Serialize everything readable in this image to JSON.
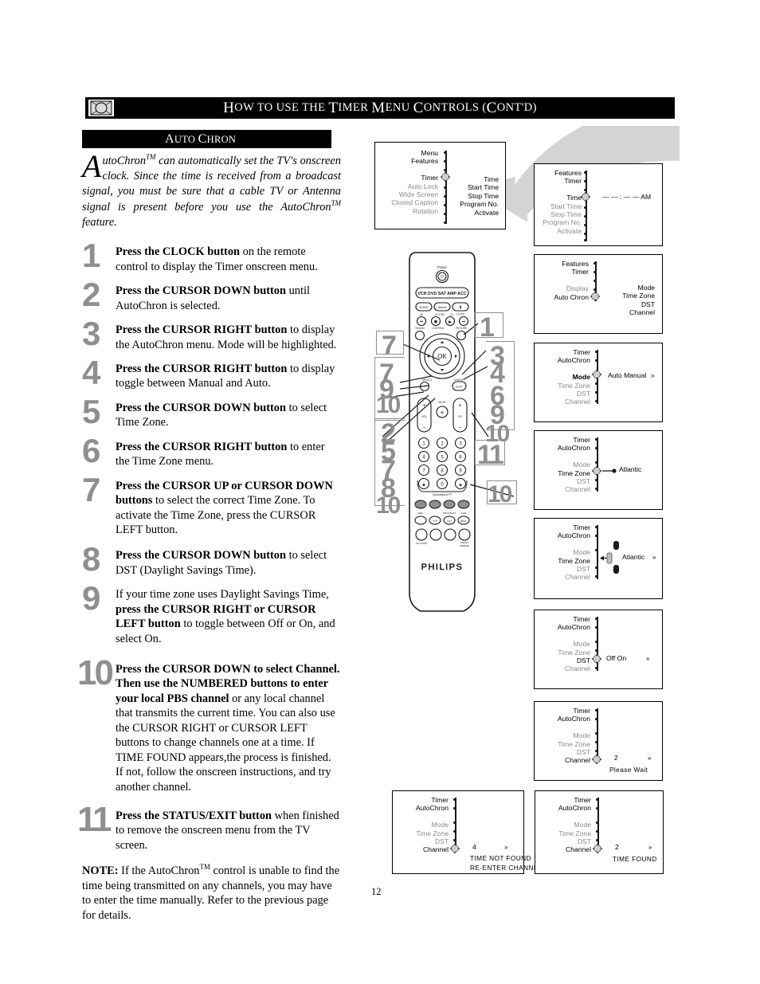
{
  "header": {
    "icon": "tv-remote-icon",
    "title_parts": [
      "H",
      "OW TO USE THE ",
      "T",
      "IMER ",
      "M",
      "ENU ",
      "C",
      "ONTROLS (",
      "C",
      "ONT",
      "'",
      "D)"
    ],
    "title": "How to use the Timer Menu Controls (Cont'd)"
  },
  "section": {
    "title_first": "A",
    "title_rest1": "UTO ",
    "title_second": "C",
    "title_rest2": "HRON",
    "title": "Auto Chron"
  },
  "intro": {
    "dropcap": "A",
    "text_1": "utoChron",
    "tm": "TM",
    "text_2": " can automatically set the TV's onscreen clock. Since the time is received from a broadcast signal, you must be sure that a cable TV or Antenna signal is present before you use the AutoChron",
    "tm2": "TM",
    "text_3": " feature."
  },
  "steps": [
    {
      "num": "1",
      "bold": "Press the CLOCK button",
      "rest": " on the remote control to display the Timer onscreen menu."
    },
    {
      "num": "2",
      "bold": "Press the CURSOR DOWN button",
      "rest": " until AutoChron is selected."
    },
    {
      "num": "3",
      "bold": "Press the CURSOR RIGHT button",
      "rest": " to display the AutoChron menu. Mode will be highlighted."
    },
    {
      "num": "4",
      "bold": "Press the CURSOR RIGHT button",
      "rest": " to display toggle between Manual and Auto."
    },
    {
      "num": "5",
      "bold": "Press the CURSOR DOWN button",
      "rest": " to select Time Zone."
    },
    {
      "num": "6",
      "bold": "Press the CURSOR RIGHT button",
      "rest": " to enter the Time Zone menu."
    },
    {
      "num": "7",
      "bold": "Press the CURSOR UP or CURSOR DOWN buttons",
      "rest": " to select the correct Time Zone. To activate the Time Zone, press the CURSOR LEFT button."
    },
    {
      "num": "8",
      "bold": "Press the CURSOR DOWN button",
      "rest": " to select DST (Daylight Savings Time)."
    },
    {
      "num": "9",
      "pre": "If your time zone uses Daylight Savings Time, ",
      "bold": "press the CURSOR RIGHT or CURSOR LEFT button",
      "rest": " to toggle between Off or On, and select On."
    },
    {
      "num": "10",
      "bold": "Press the CURSOR DOWN to select Channel. Then use the NUMBERED buttons to enter your local PBS channel",
      "rest": " or any local channel that transmits the current time.  You can also use the CURSOR RIGHT or CURSOR LEFT buttons to change channels one at a time. If TIME FOUND appears,the process is finished. If not, follow the onscreen instructions, and try another channel."
    },
    {
      "num": "11",
      "bold": "Press the STATUS/EXIT button",
      "rest": " when finished to remove the onscreen menu from the TV screen."
    }
  ],
  "note": {
    "label": "NOTE:",
    "text_1": " If the AutoChron",
    "tm": "TM",
    "text_2": " control is unable to find the time being transmitted on any channels, you may have to enter the time manually. Refer to the previous page for details."
  },
  "page_number": "12",
  "osd_screens": [
    {
      "id": "osd-menu-features",
      "left_items": [
        "Menu",
        "Features",
        "",
        "Timer",
        "Auto Lock",
        "Wide Screen",
        "Closed Caption",
        "Rotation"
      ],
      "highlight_index": 3,
      "right_items": [
        "Time",
        "Start Time",
        "Stop Time",
        "Program No.",
        "Activate"
      ],
      "value": ""
    },
    {
      "id": "osd-time",
      "left_items": [
        "Features",
        "Timer",
        "",
        "Time",
        "Start Time",
        "Stop Time",
        "Program No.",
        "Activate"
      ],
      "highlight_index": 3,
      "right_items": [],
      "value": "— — : — —  AM"
    },
    {
      "id": "osd-autochron-select",
      "left_items": [
        "Features",
        "Timer",
        "",
        "Display",
        "Auto Chron"
      ],
      "highlight_index": 4,
      "right_items": [
        "Mode",
        "Time Zone",
        "DST",
        "Channel"
      ],
      "value": ""
    },
    {
      "id": "osd-mode",
      "left_items": [
        "Timer",
        "AutoChron",
        "",
        "Mode",
        "Time Zone",
        "DST",
        "Channel"
      ],
      "highlight_index": 3,
      "right_items": [],
      "value": "Auto     Manual",
      "value_arrow": "»"
    },
    {
      "id": "osd-timezone-enter",
      "left_items": [
        "Timer",
        "AutoChron",
        "",
        "Mode",
        "Time Zone",
        "DST",
        "Channel"
      ],
      "highlight_index": 4,
      "right_items": [],
      "value": "Atlantic"
    },
    {
      "id": "osd-timezone-list",
      "left_items": [
        "Timer",
        "AutoChron",
        "",
        "Mode",
        "Time Zone",
        "DST",
        "Channel"
      ],
      "highlight_index": 4,
      "right_items": [],
      "value": "Atlantic",
      "value_arrow": "»"
    },
    {
      "id": "osd-dst",
      "left_items": [
        "Timer",
        "AutoChron",
        "",
        "Mode",
        "Time Zone",
        "DST",
        "Channel"
      ],
      "highlight_index": 5,
      "right_items": [],
      "value": "Off        On",
      "value_arrow": "»"
    },
    {
      "id": "osd-channel-wait",
      "left_items": [
        "Timer",
        "AutoChron",
        "",
        "Mode",
        "Time Zone",
        "DST",
        "Channel"
      ],
      "highlight_index": 6,
      "right_items": [],
      "value": "2",
      "value_arrow": "»",
      "message1": "Please Wait"
    },
    {
      "id": "osd-time-not-found",
      "left_items": [
        "Timer",
        "AutoChron",
        "",
        "Mode",
        "Time Zone",
        "DST",
        "Channel"
      ],
      "highlight_index": 6,
      "right_items": [],
      "value": "4",
      "value_arrow": "»",
      "message1": "TIME NOT FOUND",
      "message2": "RE-ENTER CHANNEL"
    },
    {
      "id": "osd-time-found",
      "left_items": [
        "Timer",
        "AutoChron",
        "",
        "Mode",
        "Time Zone",
        "DST",
        "Channel"
      ],
      "highlight_index": 6,
      "right_items": [],
      "value": "2",
      "value_arrow": "»",
      "message1": "TIME FOUND"
    }
  ],
  "remote": {
    "brand": "PHILIPS",
    "power_label": "Power",
    "mode_row": "VCR DVD SAT AMP ACC",
    "buttons": {
      "sleep": "SLEEP",
      "select": "Select",
      "pause": "II",
      "clock": "CLOCK",
      "ok": "OK",
      "status": "STATUS",
      "exit": "EXIT",
      "mute": "MUTE",
      "vol": "VOL",
      "ch": "CH",
      "av": "AV",
      "active": "ACTIVE",
      "cc": "CC",
      "sound": "SOUND",
      "control": "CONTROL",
      "picture": "PICTURE",
      "select_small": "SELECT",
      "quadrasurf": "Quadrasurf",
      "rec": "REC",
      "program": "PROGRAM",
      "acm": "ACM",
      "picture_small": "PICTURE",
      "smart": "SMART",
      "freeze": "FREEZE"
    },
    "keypad": [
      "1",
      "2",
      "3",
      "4",
      "5",
      "6",
      "7",
      "8",
      "9",
      "0"
    ]
  },
  "callouts": [
    {
      "label": "1",
      "name": "callout-clock"
    },
    {
      "label": "7",
      "name": "callout-cursor-up"
    },
    {
      "label": "7",
      "name": "callout-cursor-left-7"
    },
    {
      "label": "9",
      "name": "callout-cursor-left-9"
    },
    {
      "label": "10",
      "name": "callout-cursor-left-10"
    },
    {
      "label": "3",
      "name": "callout-cursor-right-3"
    },
    {
      "label": "4",
      "name": "callout-cursor-right-4"
    },
    {
      "label": "6",
      "name": "callout-cursor-right-6"
    },
    {
      "label": "9",
      "name": "callout-cursor-right-9"
    },
    {
      "label": "10",
      "name": "callout-cursor-right-10"
    },
    {
      "label": "2",
      "name": "callout-cursor-down-2"
    },
    {
      "label": "5",
      "name": "callout-cursor-down-5"
    },
    {
      "label": "7",
      "name": "callout-cursor-down-7"
    },
    {
      "label": "8",
      "name": "callout-cursor-down-8"
    },
    {
      "label": "10",
      "name": "callout-cursor-down-10"
    },
    {
      "label": "11",
      "name": "callout-status-exit"
    },
    {
      "label": "10",
      "name": "callout-numbered-buttons"
    }
  ]
}
